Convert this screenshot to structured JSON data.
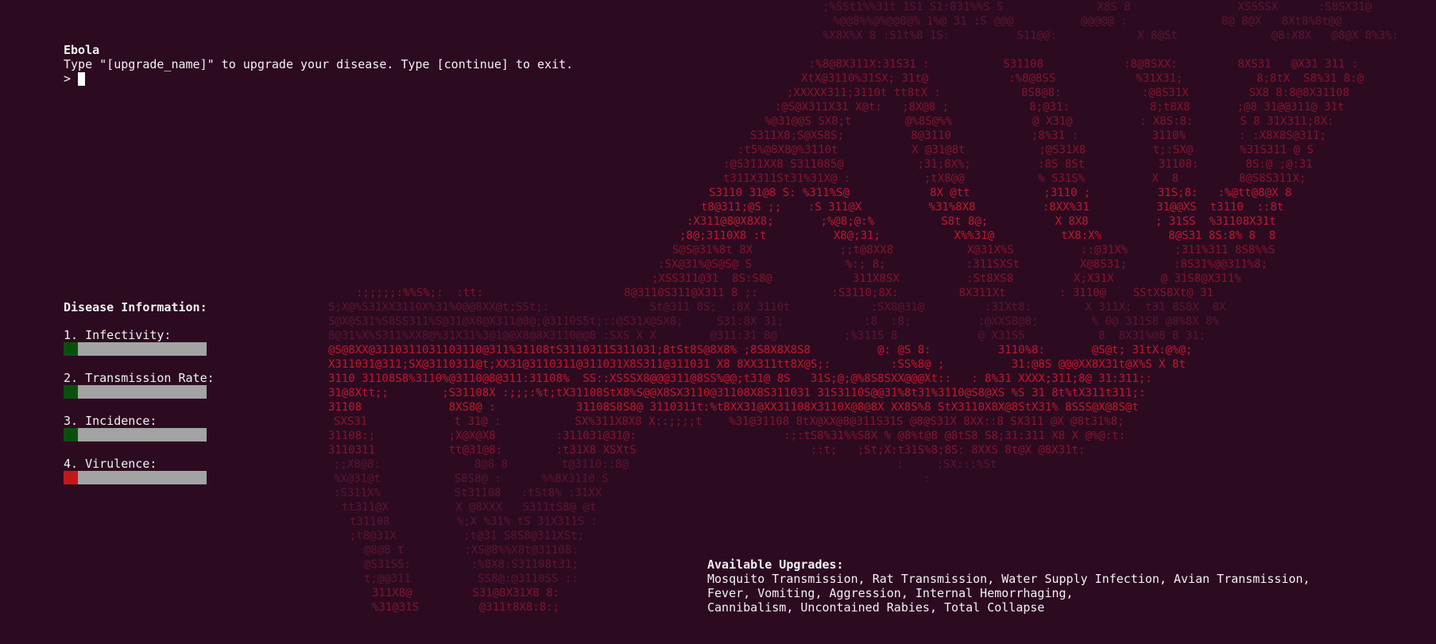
{
  "terminal": {
    "disease_name": "Ebola",
    "instruction": "Type \"[upgrade_name]\" to upgrade your disease. Type [continue] to exit.",
    "prompt_symbol": ">"
  },
  "disease_info": {
    "heading": "Disease Information:",
    "stats": [
      {
        "label": "1. Infectivity:",
        "level": 0.1,
        "color": "#0b4f0f"
      },
      {
        "label": "2. Transmission Rate:",
        "level": 0.1,
        "color": "#0b4f0f"
      },
      {
        "label": "3. Incidence:",
        "level": 0.1,
        "color": "#0b4f0f"
      },
      {
        "label": "4. Virulence:",
        "level": 0.1,
        "color": "#c41818"
      }
    ]
  },
  "upgrades": {
    "heading": "Available Upgrades:",
    "lines": [
      "Mosquito Transmission, Rat Transmission, Water Supply Infection, Avian Transmission,",
      "Fever, Vomiting, Aggression, Internal Hemorrhaging,",
      "Cannibalism, Uncontained Rabies, Total Collapse"
    ]
  },
  "colors": {
    "background": "#2c0b21",
    "text": "#f2f2f2",
    "art": "#a8162b",
    "bar_empty": "#a3a3a3"
  }
}
